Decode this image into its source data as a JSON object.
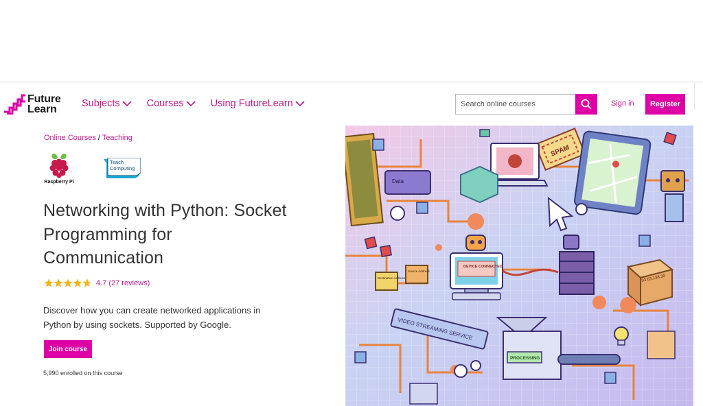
{
  "header": {
    "logo": {
      "line1": "Future",
      "line2": "Learn"
    },
    "nav": [
      {
        "label": "Subjects"
      },
      {
        "label": "Courses"
      },
      {
        "label": "Using FutureLearn"
      }
    ],
    "search": {
      "placeholder": "Search online courses"
    },
    "signin_label": "Sign in",
    "register_label": "Register"
  },
  "breadcrumb": {
    "item1": "Online Courses",
    "separator": " / ",
    "item2": "Teaching"
  },
  "partners": {
    "raspberry_pi": "Raspberry Pi",
    "teach_line1": "Teach",
    "teach_line2": "Computing"
  },
  "course": {
    "title": "Networking with Python: Socket Programming for Communication",
    "rating": {
      "stars": 4.7,
      "label": "4.7 (27 reviews)"
    },
    "description": "Discover how you can create networked applications in Python by using sockets. Supported by Google.",
    "join_label": "Join course",
    "enrolled": "5,990 enrolled on this course"
  },
  "hero": {
    "labels": {
      "spam": "SPAM",
      "device": "DEVICE CONNECTED",
      "video": "VIDEO STREAMING SERVICE",
      "processing": "PROCESSING",
      "data": "Data",
      "ip": "93.63.138.39",
      "dest": "Destination Address",
      "source": "Source Address"
    }
  },
  "colors": {
    "brand_pink": "#de00a5",
    "link_pink": "#c2198c",
    "star": "#f1b81d"
  },
  "icons": [
    "future-learn-logo-icon",
    "chevron-down-icon",
    "search-icon",
    "star-icon",
    "raspberry-pi-logo-icon",
    "teach-computing-logo-icon"
  ]
}
